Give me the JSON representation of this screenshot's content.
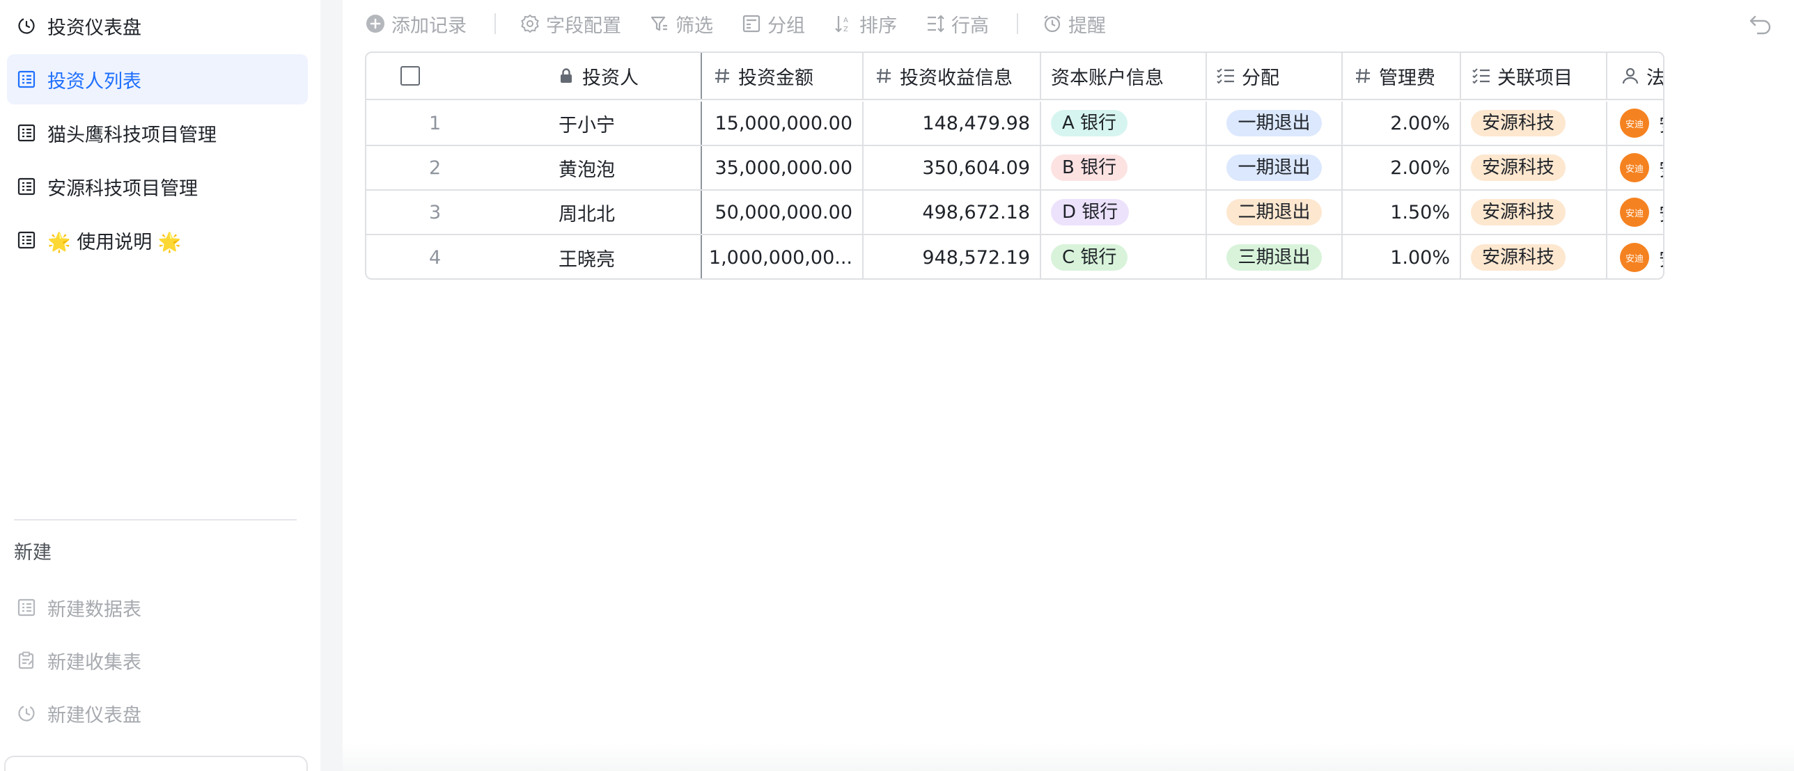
{
  "sidebar": {
    "items": [
      {
        "label": "投资仪表盘",
        "icon": "dashboard-icon"
      },
      {
        "label": "投资人列表",
        "icon": "table-icon",
        "active": true
      },
      {
        "label": "猫头鹰科技项目管理",
        "icon": "table-icon"
      },
      {
        "label": "安源科技项目管理",
        "icon": "table-icon"
      },
      {
        "label": "🌟 使用说明 🌟",
        "icon": "table-icon"
      }
    ],
    "new_section": "新建",
    "new_items": [
      {
        "label": "新建数据表",
        "icon": "table-icon"
      },
      {
        "label": "新建收集表",
        "icon": "form-icon"
      },
      {
        "label": "新建仪表盘",
        "icon": "dashboard-icon"
      }
    ]
  },
  "toolbar": {
    "add_record": "添加记录",
    "field_config": "字段配置",
    "filter": "筛选",
    "group": "分组",
    "sort": "排序",
    "row_height": "行高",
    "reminder": "提醒"
  },
  "table": {
    "columns": {
      "investor": "投资人",
      "amount": "投资金额",
      "returns": "投资收益信息",
      "account": "资本账户信息",
      "distribution": "分配",
      "fee": "管理费",
      "project": "关联项目",
      "legal": "法务合同"
    },
    "rows": [
      {
        "index": "1",
        "investor": "于小宁",
        "amount": "15,000,000.00",
        "returns": "148,479.98",
        "account": "A 银行",
        "account_color": "#d7f5f0",
        "distribution": "一期退出",
        "dist_color": "#dce8fd",
        "fee": "2.00%",
        "project": "安源科技",
        "legal_avatar": "安迪",
        "legal": "安迪"
      },
      {
        "index": "2",
        "investor": "黄泡泡",
        "amount": "35,000,000.00",
        "returns": "350,604.09",
        "account": "B 银行",
        "account_color": "#fde2e2",
        "distribution": "一期退出",
        "dist_color": "#dce8fd",
        "fee": "2.00%",
        "project": "安源科技",
        "legal_avatar": "安迪",
        "legal": "安迪"
      },
      {
        "index": "3",
        "investor": "周北北",
        "amount": "50,000,000.00",
        "returns": "498,672.18",
        "account": "D 银行",
        "account_color": "#ede2fc",
        "distribution": "二期退出",
        "dist_color": "#fde7cf",
        "fee": "1.50%",
        "project": "安源科技",
        "legal_avatar": "安迪",
        "legal": "安迪"
      },
      {
        "index": "4",
        "investor": "王晓亮",
        "amount": "1,000,000,00...",
        "returns": "948,572.19",
        "account": "C 银行",
        "account_color": "#d8f3da",
        "distribution": "三期退出",
        "dist_color": "#d8f3da",
        "fee": "1.00%",
        "project": "安源科技",
        "legal_avatar": "安迪",
        "legal": "安迪"
      }
    ],
    "project_color": "#fde7cf"
  }
}
